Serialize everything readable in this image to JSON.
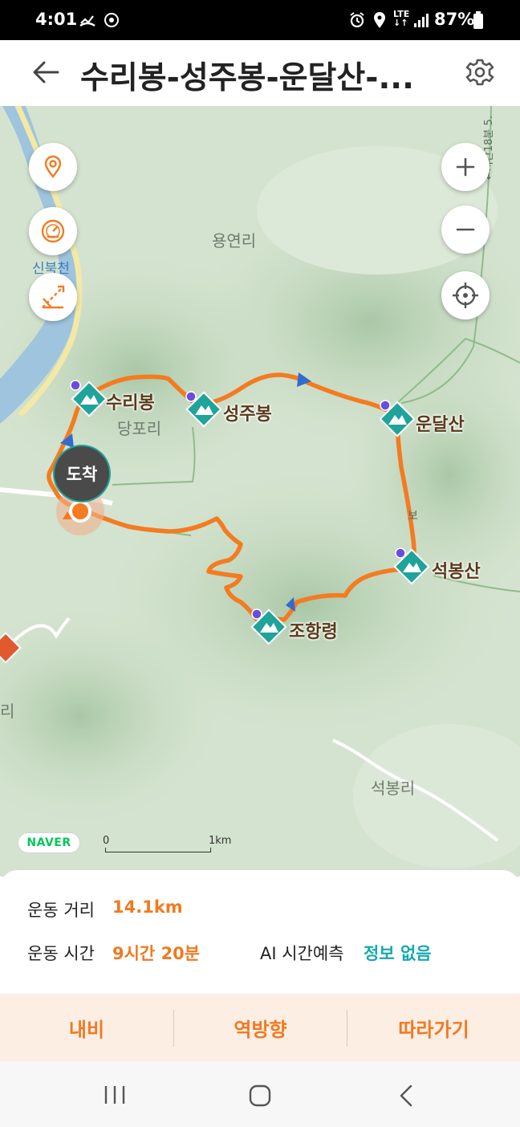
{
  "status_bar": {
    "time": "4:01",
    "battery": "87%",
    "icons": [
      "missed-call-icon",
      "sync-icon",
      "alarm-icon",
      "location-icon",
      "lte-icon",
      "signal-icon",
      "battery-icon"
    ]
  },
  "header": {
    "title": "수리봉-성주봉-운달산-..."
  },
  "map": {
    "provider": "NAVER",
    "scale_zero": "0",
    "scale_unit": "1km",
    "arrival_badge": "도착",
    "place_labels": {
      "yongyeon_ri": "용연리",
      "sinbukcheon": "신북천",
      "dangpo_ri": "당포리",
      "seokbong_ri": "석봉리",
      "edge_ri": "리",
      "road_sign": "←시간18분 5.",
      "trail_fragment": "보"
    },
    "peaks": {
      "suribong": "수리봉",
      "seongjubong": "성주봉",
      "undalsan": "운달산",
      "seokbongsan": "석봉산",
      "johangryeong": "조항령"
    },
    "colors": {
      "route": "#f47b20",
      "peak_marker": "#1ea49a",
      "map_green": "#cfe0c9"
    }
  },
  "info": {
    "distance_label": "운동 거리",
    "distance_value": "14.1km",
    "time_label": "운동 시간",
    "time_value": "9시간 20분",
    "ai_label": "AI 시간예측",
    "ai_value": "정보 없음"
  },
  "actions": {
    "navi": "내비",
    "reverse": "역방향",
    "follow": "따라가기"
  }
}
